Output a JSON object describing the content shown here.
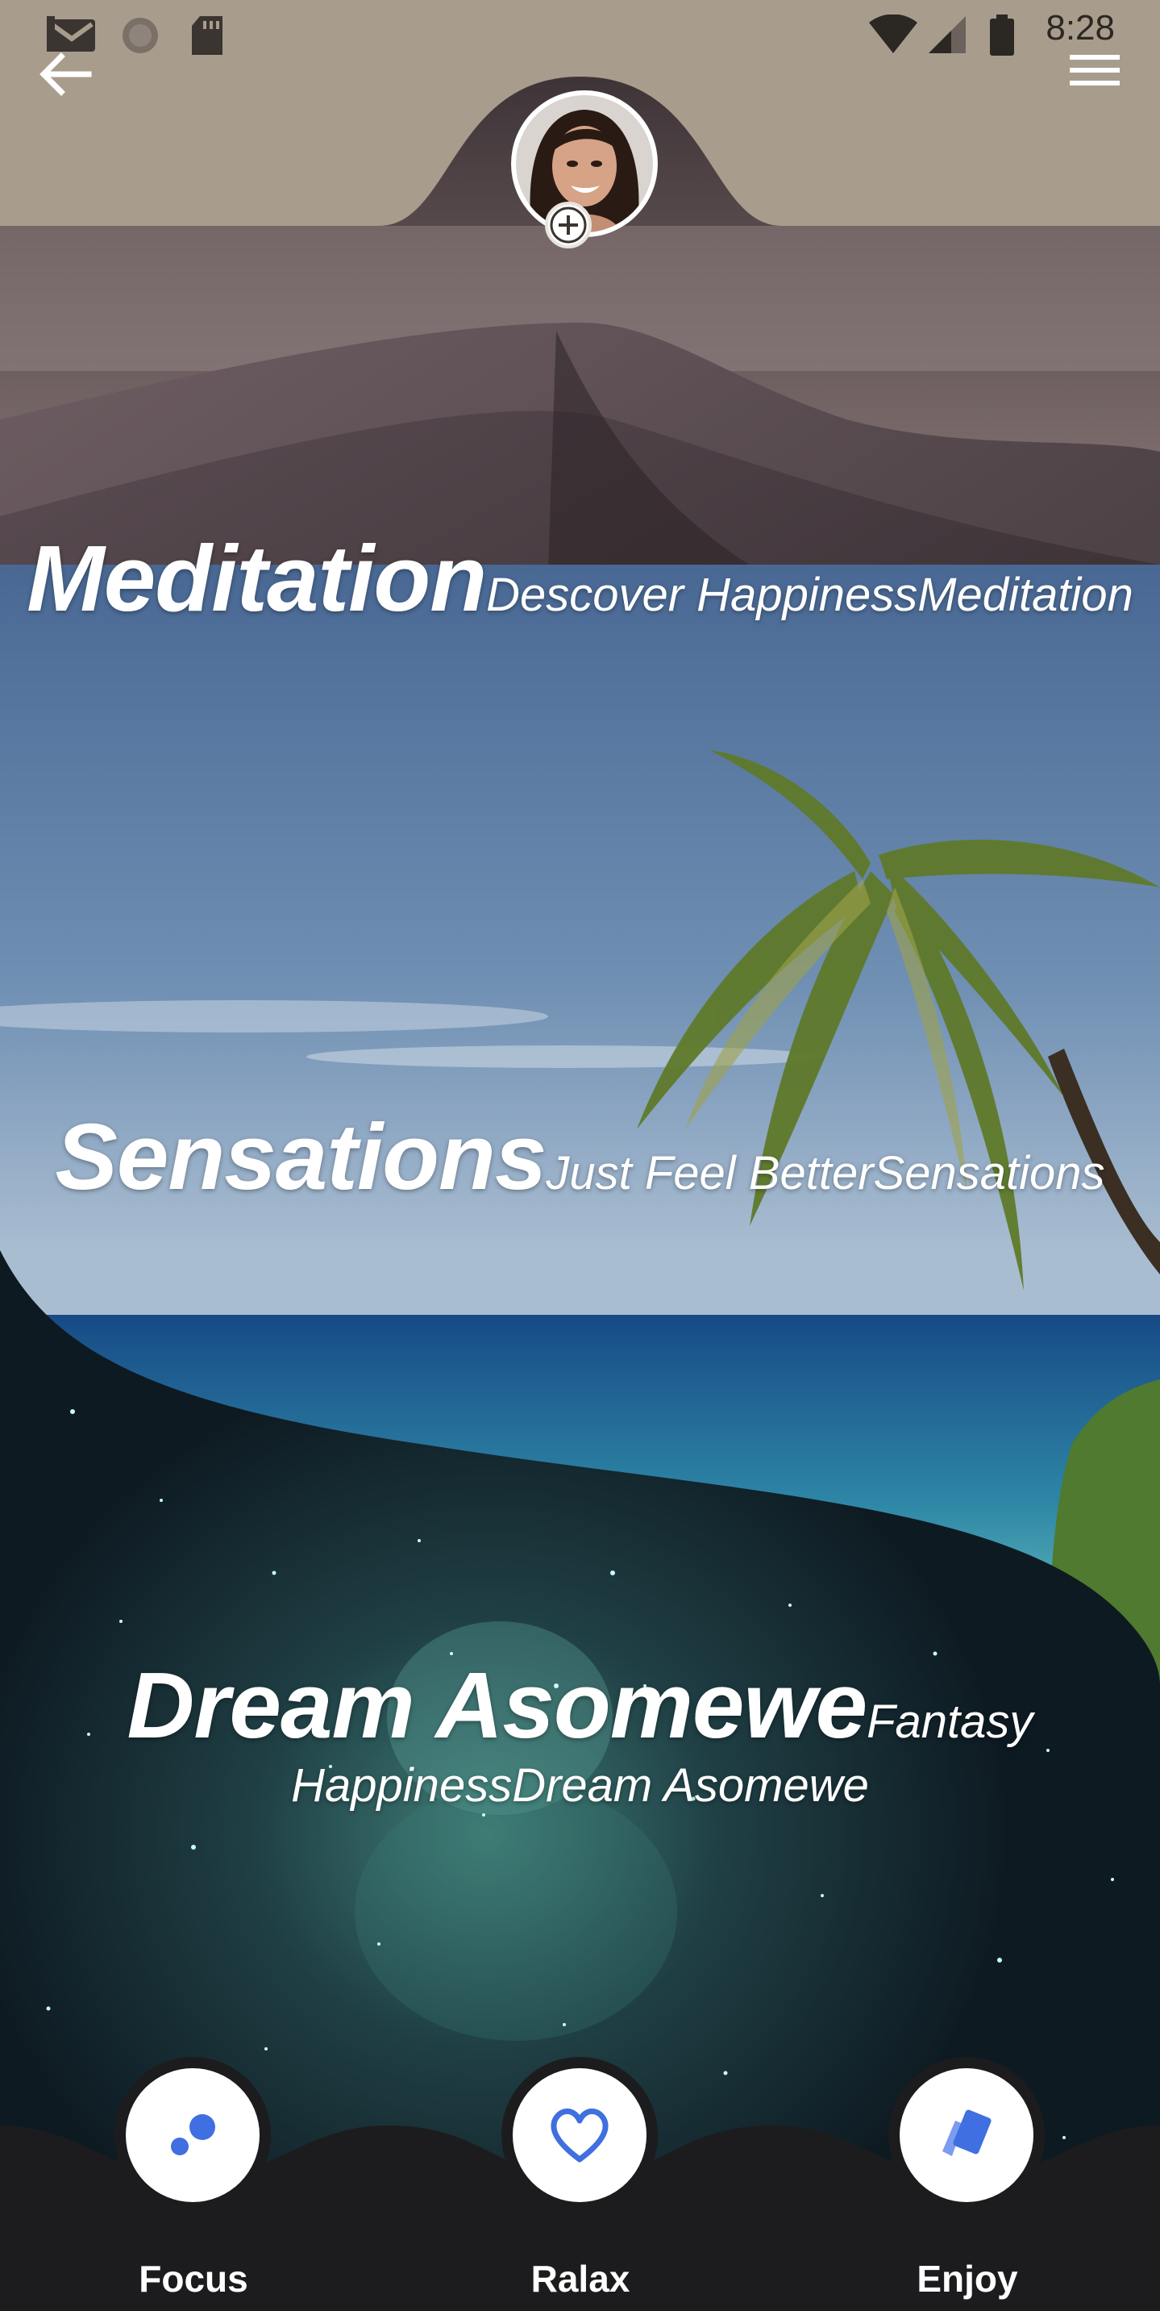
{
  "status_bar": {
    "time": "8:28",
    "icons": [
      "gmail-icon",
      "sync-icon",
      "sd-card-icon",
      "wifi-icon",
      "signal-icon",
      "battery-icon"
    ]
  },
  "header": {
    "back_icon": "arrow-left-icon",
    "menu_icon": "hamburger-menu-icon",
    "avatar_add_icon": "plus-icon"
  },
  "sections": [
    {
      "title": "Meditation",
      "subtitle": "Descover HappinessMeditation"
    },
    {
      "title": "Sensations",
      "subtitle": "Just Feel BetterSensations"
    },
    {
      "title": "Dream Asomewe",
      "subtitle_line1": "Fantasy",
      "subtitle_line2": "HappinessDream Asomewe"
    }
  ],
  "bottom_nav": {
    "items": [
      {
        "label": "Focus",
        "icon": "bubbles-icon"
      },
      {
        "label": "Ralax",
        "icon": "heart-icon"
      },
      {
        "label": "Enjoy",
        "icon": "cards-icon"
      }
    ],
    "accent_color": "#3f6fe0"
  },
  "colors": {
    "header_bg": "#a89c8c",
    "nav_bg": "#1c1c1e",
    "text": "#ffffff"
  }
}
